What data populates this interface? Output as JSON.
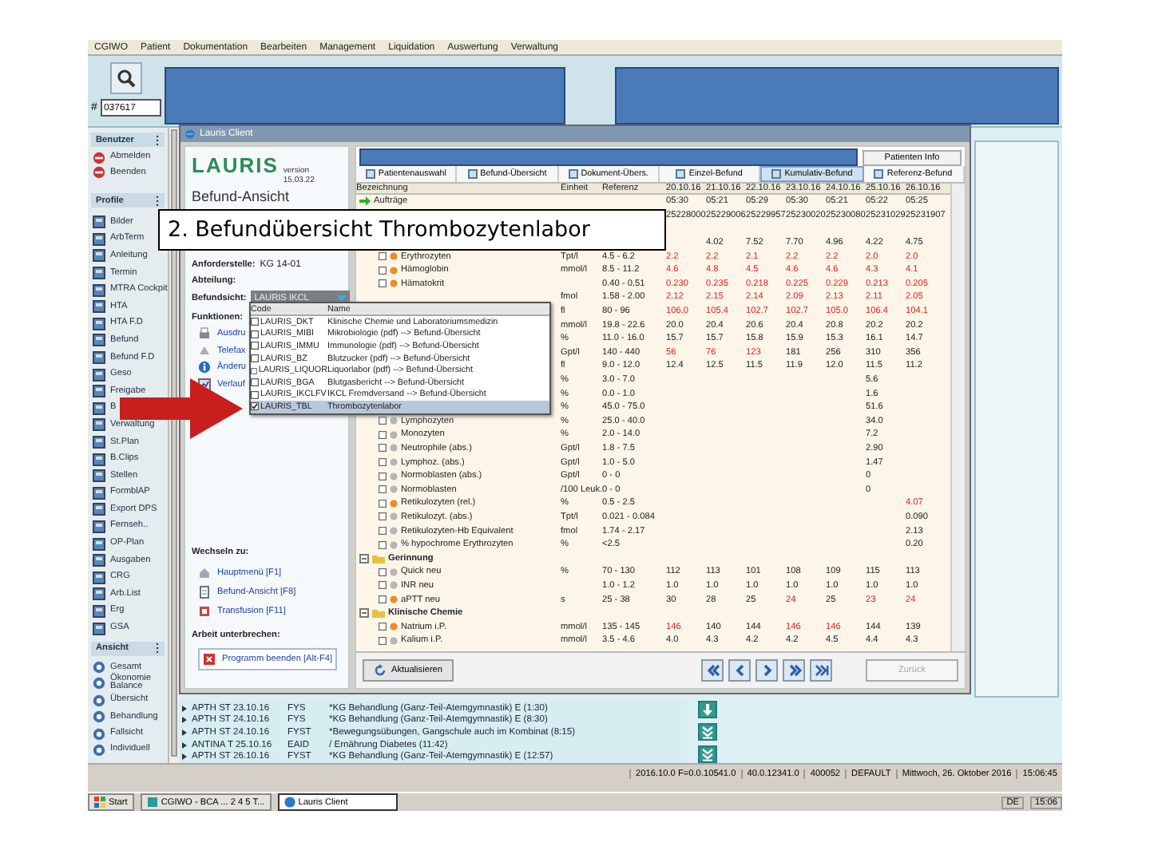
{
  "menu": [
    "CGIWO",
    "Patient",
    "Dokumentation",
    "Bearbeiten",
    "Management",
    "Liquidation",
    "Auswertung",
    "Verwaltung"
  ],
  "topbar": {
    "hash": "#",
    "patient_number": "037617"
  },
  "sidebar": {
    "sections": [
      {
        "title": "Benutzer",
        "kind": "user",
        "items": [
          {
            "label": "Abmelden"
          },
          {
            "label": "Beenden"
          }
        ]
      },
      {
        "title": "Profile",
        "kind": "module",
        "items": [
          {
            "label": "Bilder"
          },
          {
            "label": "ArbTerm"
          },
          {
            "label": "Anleitung"
          },
          {
            "label": "Termin"
          },
          {
            "label": "MTRA Cockpit"
          },
          {
            "label": "HTA"
          },
          {
            "label": "HTA F.D"
          },
          {
            "label": "Befund"
          },
          {
            "label": "Befund F.D"
          },
          {
            "label": "Geso"
          },
          {
            "label": "Freigabe"
          },
          {
            "label": "B"
          },
          {
            "label": "Verwaltung"
          },
          {
            "label": "St.Plan"
          },
          {
            "label": "B.Clips"
          },
          {
            "label": "Stellen"
          },
          {
            "label": "FormblAP"
          },
          {
            "label": "Export DPS"
          },
          {
            "label": "Fernseh.."
          },
          {
            "label": "OP-Plan"
          },
          {
            "label": "Ausgaben"
          },
          {
            "label": "CRG"
          },
          {
            "label": "Arb.List"
          },
          {
            "label": "Erg"
          },
          {
            "label": "GSA"
          }
        ]
      },
      {
        "title": "Ansicht",
        "kind": "view",
        "items": [
          {
            "label": "Gesamt"
          },
          {
            "label": "Ökonomie Balance"
          },
          {
            "label": "Übersicht"
          },
          {
            "label": "Behandlung"
          },
          {
            "label": "Fallsicht"
          },
          {
            "label": "Individuell"
          }
        ]
      }
    ]
  },
  "lauris": {
    "title": "Lauris Client",
    "logo": "LAURIS",
    "version": "version 15.03.22",
    "view_title": "Befund-Ansicht",
    "requester_label": "Anforderstelle:",
    "requester": "KG 14-01",
    "department_label": "Abteilung:",
    "view_label": "Befundsicht:",
    "view_value": "LAURIS IKCL",
    "functions_label": "Funktionen:",
    "functions": [
      {
        "kind": "print",
        "label": "Ausdru"
      },
      {
        "kind": "fax",
        "label": "Telefax"
      },
      {
        "kind": "info",
        "label": "Änderu"
      },
      {
        "kind": "chart",
        "label": "Verlauf"
      }
    ],
    "switch_label": "Wechseln zu:",
    "switch_links": [
      {
        "kind": "home",
        "label": "Hauptmenü [F1]"
      },
      {
        "kind": "doc",
        "label": "Befund-Ansicht [F8]"
      },
      {
        "kind": "blood",
        "label": "Transfusion [F11]"
      }
    ],
    "interrupt_label": "Arbeit unterbrechen:",
    "quit": "Programm beenden [Alt-F4]",
    "patient_info": "Patienten Info",
    "tabs": [
      {
        "label": "Patientenauswahl",
        "selected": false
      },
      {
        "label": "Befund-Übersicht",
        "selected": false
      },
      {
        "label": "Dokument-Übers.",
        "selected": false
      },
      {
        "label": "Einzel-Befund",
        "selected": false
      },
      {
        "label": "Kumulativ-Befund",
        "selected": true
      },
      {
        "label": "Referenz-Befund",
        "selected": false
      }
    ],
    "table": {
      "columns": [
        "Bezeichnung",
        "Einheit",
        "Referenz",
        "20.10.16",
        "21.10.16",
        "22.10.16",
        "23.10.16",
        "24.10.16",
        "25.10.16",
        "26.10.16"
      ],
      "rows": [
        {
          "kind": "orders",
          "name": "Aufträge",
          "values": [
            "05:30",
            "05:21",
            "05:29",
            "05:30",
            "05:21",
            "05:22",
            "05:25"
          ]
        },
        {
          "kind": "plain",
          "values": [
            "25228000",
            "25229006",
            "25229957",
            "25230020",
            "25230080",
            "25231029",
            "25231907"
          ]
        },
        {
          "kind": "spacer"
        },
        {
          "kind": "plain",
          "values": [
            {
              "kind": "blank"
            },
            "4.02",
            "7.52",
            "7.70",
            "4.96",
            "4.22",
            "4.75"
          ]
        },
        {
          "kind": "test",
          "name": "Erythrozyten",
          "checked": false,
          "flagged": true,
          "unit": "Tpt/l",
          "ref": "4.5 - 6.2",
          "values": [
            {
              "kind": "abnormal",
              "text": "2.2"
            },
            {
              "kind": "abnormal",
              "text": "2.2"
            },
            {
              "kind": "abnormal",
              "text": "2.1"
            },
            {
              "kind": "abnormal",
              "text": "2.2"
            },
            {
              "kind": "abnormal",
              "text": "2.2"
            },
            {
              "kind": "abnormal",
              "text": "2.0"
            },
            {
              "kind": "abnormal",
              "text": "2.0"
            }
          ]
        },
        {
          "kind": "test",
          "name": "Hämoglobin",
          "checked": false,
          "flagged": true,
          "unit": "mmol/l",
          "ref": "8.5 - 11.2",
          "values": [
            {
              "kind": "abnormal",
              "text": "4.6"
            },
            {
              "kind": "abnormal",
              "text": "4.8"
            },
            {
              "kind": "abnormal",
              "text": "4.5"
            },
            {
              "kind": "abnormal",
              "text": "4.6"
            },
            {
              "kind": "abnormal",
              "text": "4.6"
            },
            {
              "kind": "abnormal",
              "text": "4.3"
            },
            {
              "kind": "abnormal",
              "text": "4.1"
            }
          ]
        },
        {
          "kind": "test",
          "name": "Hämatokrit",
          "checked": false,
          "flagged": true,
          "ref": "0.40 - 0.51",
          "values": [
            {
              "kind": "abnormal",
              "text": "0.230"
            },
            {
              "kind": "abnormal",
              "text": "0.235"
            },
            {
              "kind": "abnormal",
              "text": "0.218"
            },
            {
              "kind": "abnormal",
              "text": "0.225"
            },
            {
              "kind": "abnormal",
              "text": "0.229"
            },
            {
              "kind": "abnormal",
              "text": "0.213"
            },
            {
              "kind": "abnormal",
              "text": "0.205"
            }
          ]
        },
        {
          "kind": "test",
          "unit": "fmol",
          "ref": "1.58 - 2.00",
          "values": [
            {
              "kind": "abnormal",
              "text": "2.12"
            },
            {
              "kind": "abnormal",
              "text": "2.15"
            },
            {
              "kind": "abnormal",
              "text": "2.14"
            },
            {
              "kind": "abnormal",
              "text": "2.09"
            },
            {
              "kind": "abnormal",
              "text": "2.13"
            },
            {
              "kind": "abnormal",
              "text": "2.11"
            },
            {
              "kind": "abnormal",
              "text": "2.05"
            }
          ]
        },
        {
          "kind": "test",
          "unit": "fl",
          "ref": "80 - 96",
          "values": [
            {
              "kind": "abnormal",
              "text": "106.0"
            },
            {
              "kind": "abnormal",
              "text": "105.4"
            },
            {
              "kind": "abnormal",
              "text": "102.7"
            },
            {
              "kind": "abnormal",
              "text": "102.7"
            },
            {
              "kind": "abnormal",
              "text": "105.0"
            },
            {
              "kind": "abnormal",
              "text": "106.4"
            },
            {
              "kind": "abnormal",
              "text": "104.1"
            }
          ]
        },
        {
          "kind": "test",
          "unit": "mmol/l",
          "ref": "19.8 - 22.6",
          "values": [
            "20.0",
            "20.4",
            "20.6",
            "20.4",
            "20.8",
            "20.2",
            "20.2"
          ]
        },
        {
          "kind": "test",
          "unit": "%",
          "ref": "11.0 - 16.0",
          "values": [
            "15.7",
            "15.7",
            "15.8",
            "15.9",
            "15.3",
            "16.1",
            "14.7"
          ]
        },
        {
          "kind": "test",
          "unit": "Gpt/l",
          "ref": "140 - 440",
          "values": [
            {
              "kind": "abnormal",
              "text": "56"
            },
            {
              "kind": "abnormal",
              "text": "76"
            },
            {
              "kind": "abnormal",
              "text": "123"
            },
            "181",
            "256",
            "310",
            "356"
          ]
        },
        {
          "kind": "test",
          "unit": "fl",
          "ref": "9.0 - 12.0",
          "values": [
            "12.4",
            "12.5",
            "11.5",
            "11.9",
            "12.0",
            "11.5",
            "11.2"
          ]
        },
        {
          "kind": "test",
          "unit": "%",
          "ref": "3.0 - 7.0",
          "values": [
            {
              "kind": "blank"
            },
            {
              "kind": "blank"
            },
            {
              "kind": "blank"
            },
            {
              "kind": "blank"
            },
            {
              "kind": "blank"
            },
            "5.6"
          ]
        },
        {
          "kind": "test",
          "unit": "%",
          "ref": "0.0 - 1.0",
          "values": [
            {
              "kind": "blank"
            },
            {
              "kind": "blank"
            },
            {
              "kind": "blank"
            },
            {
              "kind": "blank"
            },
            {
              "kind": "blank"
            },
            "1.6"
          ]
        },
        {
          "kind": "test",
          "unit": "%",
          "ref": "45.0 - 75.0",
          "values": [
            {
              "kind": "blank"
            },
            {
              "kind": "blank"
            },
            {
              "kind": "blank"
            },
            {
              "kind": "blank"
            },
            {
              "kind": "blank"
            },
            "51.6"
          ]
        },
        {
          "kind": "test",
          "name": "Lymphozyten",
          "checked": false,
          "flagged": false,
          "unit": "%",
          "ref": "25.0 - 40.0",
          "values": [
            {
              "kind": "blank"
            },
            {
              "kind": "blank"
            },
            {
              "kind": "blank"
            },
            {
              "kind": "blank"
            },
            {
              "kind": "blank"
            },
            "34.0"
          ]
        },
        {
          "kind": "test",
          "name": "Monozyten",
          "checked": false,
          "flagged": false,
          "unit": "%",
          "ref": "2.0 - 14.0",
          "values": [
            {
              "kind": "blank"
            },
            {
              "kind": "blank"
            },
            {
              "kind": "blank"
            },
            {
              "kind": "blank"
            },
            {
              "kind": "blank"
            },
            "7.2"
          ]
        },
        {
          "kind": "test",
          "name": "Neutrophile (abs.)",
          "checked": false,
          "flagged": false,
          "unit": "Gpt/l",
          "ref": "1.8 - 7.5",
          "values": [
            {
              "kind": "blank"
            },
            {
              "kind": "blank"
            },
            {
              "kind": "blank"
            },
            {
              "kind": "blank"
            },
            {
              "kind": "blank"
            },
            "2.90"
          ]
        },
        {
          "kind": "test",
          "name": "Lymphoz. (abs.)",
          "checked": false,
          "flagged": false,
          "unit": "Gpt/l",
          "ref": "1.0 - 5.0",
          "values": [
            {
              "kind": "blank"
            },
            {
              "kind": "blank"
            },
            {
              "kind": "blank"
            },
            {
              "kind": "blank"
            },
            {
              "kind": "blank"
            },
            "1.47"
          ]
        },
        {
          "kind": "test",
          "name": "Normoblasten (abs.)",
          "checked": false,
          "flagged": false,
          "unit": "Gpt/l",
          "ref": "0 - 0",
          "values": [
            {
              "kind": "blank"
            },
            {
              "kind": "blank"
            },
            {
              "kind": "blank"
            },
            {
              "kind": "blank"
            },
            {
              "kind": "blank"
            },
            "0"
          ]
        },
        {
          "kind": "test",
          "name": "Normoblasten",
          "checked": false,
          "flagged": false,
          "unit": "/100 Leuk.",
          "ref": "0 - 0",
          "values": [
            {
              "kind": "blank"
            },
            {
              "kind": "blank"
            },
            {
              "kind": "blank"
            },
            {
              "kind": "blank"
            },
            {
              "kind": "blank"
            },
            "0"
          ]
        },
        {
          "kind": "test",
          "name": "Retikulozyten (rel.)",
          "checked": false,
          "flagged": true,
          "unit": "%",
          "ref": "0.5 - 2.5",
          "values": [
            {
              "kind": "blank"
            },
            {
              "kind": "blank"
            },
            {
              "kind": "blank"
            },
            {
              "kind": "blank"
            },
            {
              "kind": "blank"
            },
            {
              "kind": "blank"
            },
            {
              "kind": "abnormal",
              "text": "4.07"
            }
          ]
        },
        {
          "kind": "test",
          "name": "Retikulozyt. (abs.)",
          "checked": false,
          "flagged": false,
          "unit": "Tpt/l",
          "ref": "0.021 - 0.084",
          "values": [
            {
              "kind": "blank"
            },
            {
              "kind": "blank"
            },
            {
              "kind": "blank"
            },
            {
              "kind": "blank"
            },
            {
              "kind": "blank"
            },
            {
              "kind": "blank"
            },
            "0.090"
          ]
        },
        {
          "kind": "test",
          "name": "Retikulozyten-Hb Equivalent",
          "checked": false,
          "flagged": false,
          "unit": "fmol",
          "ref": "1.74 - 2.17",
          "values": [
            {
              "kind": "blank"
            },
            {
              "kind": "blank"
            },
            {
              "kind": "blank"
            },
            {
              "kind": "blank"
            },
            {
              "kind": "blank"
            },
            {
              "kind": "blank"
            },
            "2.13"
          ]
        },
        {
          "kind": "test",
          "name": "% hypochrome Erythrozyten",
          "checked": false,
          "flagged": false,
          "unit": "%",
          "ref": "<2.5",
          "values": [
            {
              "kind": "blank"
            },
            {
              "kind": "blank"
            },
            {
              "kind": "blank"
            },
            {
              "kind": "blank"
            },
            {
              "kind": "blank"
            },
            {
              "kind": "blank"
            },
            "0.20"
          ]
        },
        {
          "kind": "group",
          "name": "Gerinnung",
          "expanded": true
        },
        {
          "kind": "test",
          "name": "Quick neu",
          "checked": false,
          "flagged": false,
          "unit": "%",
          "ref": "70 - 130",
          "values": [
            "112",
            "113",
            "101",
            "108",
            "109",
            "115",
            "113"
          ]
        },
        {
          "kind": "test",
          "name": "INR neu",
          "checked": false,
          "flagged": false,
          "ref": "1.0 - 1.2",
          "values": [
            "1.0",
            "1.0",
            "1.0",
            "1.0",
            "1.0",
            "1.0",
            "1.0"
          ]
        },
        {
          "kind": "test",
          "name": "aPTT neu",
          "checked": false,
          "flagged": true,
          "unit": "s",
          "ref": "25 - 38",
          "values": [
            "30",
            "28",
            "25",
            {
              "kind": "abnormal",
              "text": "24"
            },
            "25",
            {
              "kind": "abnormal",
              "text": "23"
            },
            {
              "kind": "abnormal",
              "text": "24"
            }
          ]
        },
        {
          "kind": "group",
          "name": "Klinische Chemie",
          "expanded": true
        },
        {
          "kind": "test",
          "name": "Natrium i.P.",
          "checked": false,
          "flagged": true,
          "unit": "mmol/l",
          "ref": "135 - 145",
          "values": [
            {
              "kind": "abnormal",
              "text": "146"
            },
            "140",
            "144",
            {
              "kind": "abnormal",
              "text": "146"
            },
            {
              "kind": "abnormal",
              "text": "146"
            },
            "144",
            "139"
          ]
        },
        {
          "kind": "test",
          "name": "Kalium i.P.",
          "checked": false,
          "flagged": false,
          "unit": "mmol/l",
          "ref": "3.5 - 4.6",
          "values": [
            "4.0",
            "4.3",
            "4.2",
            "4.2",
            "4.5",
            "4.4",
            "4.3"
          ]
        }
      ]
    },
    "refresh": "Aktualisieren",
    "nav": [
      {
        "kind": "first"
      },
      {
        "kind": "previous"
      },
      {
        "kind": "next"
      },
      {
        "kind": "last"
      },
      {
        "kind": "end"
      }
    ],
    "back": {
      "label": "Zurück",
      "disabled": true
    },
    "dropdown": {
      "columns": [
        "Code",
        "Name"
      ],
      "items": [
        {
          "code": "LAURIS_DKT",
          "name": "Klinische Chemie und Laboratoriumsmedizin",
          "checked": false,
          "selected": false
        },
        {
          "code": "LAURIS_MIBI",
          "name": "Mikrobiologie (pdf) --> Befund-Übersicht",
          "checked": false,
          "selected": false
        },
        {
          "code": "LAURIS_IMMU",
          "name": "Immunologie (pdf) --> Befund-Übersicht",
          "checked": false,
          "selected": false
        },
        {
          "code": "LAURIS_BZ",
          "name": "Blutzucker (pdf) --> Befund-Übersicht",
          "checked": false,
          "selected": false
        },
        {
          "code": "LAURIS_LIQUOR",
          "name": "Liquorlabor (pdf) --> Befund-Übersicht",
          "checked": false,
          "selected": false
        },
        {
          "code": "LAURIS_BGA",
          "name": "Blutgasbericht --> Befund-Übersicht",
          "checked": false,
          "selected": false
        },
        {
          "code": "LAURIS_IKCLFV",
          "name": "IKCL Fremdversand --> Befund-Übersicht",
          "checked": false,
          "selected": false
        },
        {
          "code": "LAURIS_TBL",
          "name": "Thrombozytenlabor",
          "checked": true,
          "selected": true
        }
      ]
    }
  },
  "therapies": [
    {
      "code": "APTH ST",
      "date": "23.10.16",
      "dept": "FYS",
      "text": "*KG Behandlung (Ganz-Teil-Atemgymnastik) E (1:30)"
    },
    {
      "code": "APTH ST",
      "date": "24.10.16",
      "dept": "FYS",
      "text": "*KG Behandlung (Ganz-Teil-Atemgymnastik) E (8:30)"
    },
    {
      "code": "APTH ST",
      "date": "24.10.16",
      "dept": "FYST",
      "text": "*Bewegungsübungen, Gangschule auch im Kombinat (8:15)"
    },
    {
      "code": "ANTINA T",
      "date": "25.10.16",
      "dept": "EAID",
      "text": "/ Ernährung Diabetes (11:42)"
    },
    {
      "code": "APTH ST",
      "date": "26.10.16",
      "dept": "FYST",
      "text": "*KG Behandlung (Ganz-Teil-Atemgymnastik) E (12:57)"
    }
  ],
  "therapy_actions": [
    {
      "kind": "down"
    },
    {
      "kind": "last"
    },
    {
      "kind": "last"
    }
  ],
  "status_bar": [
    "2016.10.0 F=0.0.10541.0",
    "40.0.12341.0",
    "400052",
    "DEFAULT",
    "Mittwoch, 26. Oktober 2016",
    "15:06:45"
  ],
  "taskbar": {
    "start": "Start",
    "tasks": [
      {
        "label": "CGIWO - BCA ... 2 4 5 T...",
        "selected": false
      },
      {
        "label": "Lauris Client",
        "selected": true
      }
    ],
    "tray": [
      "DE",
      "15:06"
    ]
  },
  "callout": {
    "text": "2. Befundübersicht Thrombozytenlabor"
  }
}
